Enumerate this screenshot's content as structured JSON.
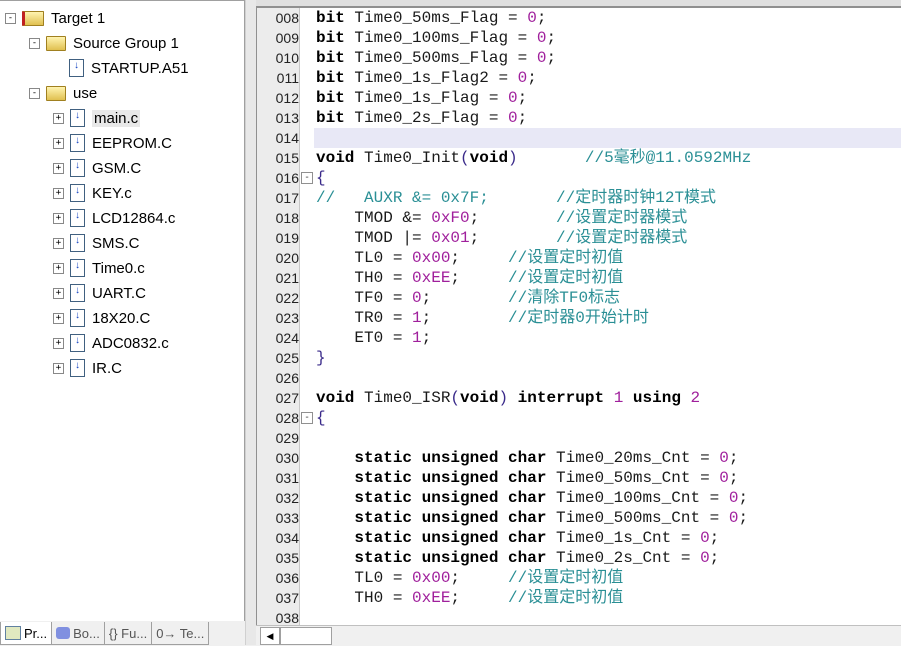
{
  "tree": [
    {
      "label": "Target 1",
      "level": 0,
      "exp": "−",
      "icon": "target"
    },
    {
      "label": "Source Group 1",
      "level": 1,
      "exp": "−",
      "icon": "folder"
    },
    {
      "label": "STARTUP.A51",
      "level": 2,
      "exp": "",
      "icon": "file"
    },
    {
      "label": "use",
      "level": 1,
      "exp": "−",
      "icon": "folder"
    },
    {
      "label": "main.c",
      "level": 2,
      "exp": "+",
      "icon": "file",
      "selected": true
    },
    {
      "label": "EEPROM.C",
      "level": 2,
      "exp": "+",
      "icon": "file"
    },
    {
      "label": "GSM.C",
      "level": 2,
      "exp": "+",
      "icon": "file"
    },
    {
      "label": "KEY.c",
      "level": 2,
      "exp": "+",
      "icon": "file"
    },
    {
      "label": "LCD12864.c",
      "level": 2,
      "exp": "+",
      "icon": "file"
    },
    {
      "label": "SMS.C",
      "level": 2,
      "exp": "+",
      "icon": "file"
    },
    {
      "label": "Time0.c",
      "level": 2,
      "exp": "+",
      "icon": "file"
    },
    {
      "label": "UART.C",
      "level": 2,
      "exp": "+",
      "icon": "file"
    },
    {
      "label": "18X20.C",
      "level": 2,
      "exp": "+",
      "icon": "file"
    },
    {
      "label": "ADC0832.c",
      "level": 2,
      "exp": "+",
      "icon": "file"
    },
    {
      "label": "IR.C",
      "level": 2,
      "exp": "+",
      "icon": "file"
    }
  ],
  "tabs": [
    {
      "label": "Pr...",
      "icon": "project-icon"
    },
    {
      "label": "Bo...",
      "icon": "books-icon"
    },
    {
      "label": "{} Fu...",
      "icon": "functions-icon"
    },
    {
      "label": "0→ Te...",
      "icon": "templates-icon"
    }
  ],
  "code": [
    {
      "ln": "008",
      "seg": [
        [
          "bit",
          "k"
        ],
        " Time0_50ms_Flag = ",
        [
          "0",
          "n"
        ],
        ";"
      ]
    },
    {
      "ln": "009",
      "seg": [
        [
          "bit",
          "k"
        ],
        " Time0_100ms_Flag = ",
        [
          "0",
          "n"
        ],
        ";"
      ]
    },
    {
      "ln": "010",
      "seg": [
        [
          "bit",
          "k"
        ],
        " Time0_500ms_Flag = ",
        [
          "0",
          "n"
        ],
        ";"
      ]
    },
    {
      "ln": "011",
      "seg": [
        [
          "bit",
          "k"
        ],
        " Time0_1s_Flag2 = ",
        [
          "0",
          "n"
        ],
        ";"
      ]
    },
    {
      "ln": "012",
      "seg": [
        [
          "bit",
          "k"
        ],
        " Time0_1s_Flag = ",
        [
          "0",
          "n"
        ],
        ";"
      ]
    },
    {
      "ln": "013",
      "seg": [
        [
          "bit",
          "k"
        ],
        " Time0_2s_Flag = ",
        [
          "0",
          "n"
        ],
        ";"
      ]
    },
    {
      "ln": "014",
      "seg": [],
      "current": true
    },
    {
      "ln": "015",
      "seg": [
        [
          "void",
          "k"
        ],
        " Time0_Init",
        [
          "(",
          "p"
        ],
        [
          "void",
          "k"
        ],
        [
          ")",
          "p"
        ],
        "       ",
        [
          "//5毫秒@11.0592MHz",
          "c"
        ]
      ]
    },
    {
      "ln": "016",
      "seg": [
        [
          "{",
          "p"
        ]
      ],
      "fold": true
    },
    {
      "ln": "017",
      "seg": [
        [
          "//   AUXR &= 0x7F;       //定时器时钟12T模式",
          "c"
        ]
      ]
    },
    {
      "ln": "018",
      "seg": [
        "    TMOD &= ",
        [
          "0xF0",
          "n"
        ],
        ";        ",
        [
          "//设置定时器模式",
          "c"
        ]
      ]
    },
    {
      "ln": "019",
      "seg": [
        "    TMOD |= ",
        [
          "0x01",
          "n"
        ],
        ";        ",
        [
          "//设置定时器模式",
          "c"
        ]
      ]
    },
    {
      "ln": "020",
      "seg": [
        "    TL0 = ",
        [
          "0x00",
          "n"
        ],
        ";     ",
        [
          "//设置定时初值",
          "c"
        ]
      ]
    },
    {
      "ln": "021",
      "seg": [
        "    TH0 = ",
        [
          "0xEE",
          "n"
        ],
        ";     ",
        [
          "//设置定时初值",
          "c"
        ]
      ]
    },
    {
      "ln": "022",
      "seg": [
        "    TF0 = ",
        [
          "0",
          "n"
        ],
        ";        ",
        [
          "//清除TF0标志",
          "c"
        ]
      ]
    },
    {
      "ln": "023",
      "seg": [
        "    TR0 = ",
        [
          "1",
          "n"
        ],
        ";        ",
        [
          "//定时器0开始计时",
          "c"
        ]
      ]
    },
    {
      "ln": "024",
      "seg": [
        "    ET0 = ",
        [
          "1",
          "n"
        ],
        ";"
      ]
    },
    {
      "ln": "025",
      "seg": [
        [
          "}",
          "p"
        ]
      ]
    },
    {
      "ln": "026",
      "seg": []
    },
    {
      "ln": "027",
      "seg": [
        [
          "void",
          "k"
        ],
        " Time0_ISR",
        [
          "(",
          "p"
        ],
        [
          "void",
          "k"
        ],
        [
          ")",
          "p"
        ],
        " ",
        [
          "interrupt",
          "k"
        ],
        " ",
        [
          "1",
          "n"
        ],
        " ",
        [
          "using",
          "k"
        ],
        " ",
        [
          "2",
          "n"
        ]
      ]
    },
    {
      "ln": "028",
      "seg": [
        [
          "{",
          "p"
        ]
      ],
      "fold": true
    },
    {
      "ln": "029",
      "seg": []
    },
    {
      "ln": "030",
      "seg": [
        "    ",
        [
          "static unsigned char",
          "k"
        ],
        " Time0_20ms_Cnt = ",
        [
          "0",
          "n"
        ],
        ";"
      ]
    },
    {
      "ln": "031",
      "seg": [
        "    ",
        [
          "static unsigned char",
          "k"
        ],
        " Time0_50ms_Cnt = ",
        [
          "0",
          "n"
        ],
        ";"
      ]
    },
    {
      "ln": "032",
      "seg": [
        "    ",
        [
          "static unsigned char",
          "k"
        ],
        " Time0_100ms_Cnt = ",
        [
          "0",
          "n"
        ],
        ";"
      ]
    },
    {
      "ln": "033",
      "seg": [
        "    ",
        [
          "static unsigned char",
          "k"
        ],
        " Time0_500ms_Cnt = ",
        [
          "0",
          "n"
        ],
        ";"
      ]
    },
    {
      "ln": "034",
      "seg": [
        "    ",
        [
          "static unsigned char",
          "k"
        ],
        " Time0_1s_Cnt = ",
        [
          "0",
          "n"
        ],
        ";"
      ]
    },
    {
      "ln": "035",
      "seg": [
        "    ",
        [
          "static unsigned char",
          "k"
        ],
        " Time0_2s_Cnt = ",
        [
          "0",
          "n"
        ],
        ";"
      ]
    },
    {
      "ln": "036",
      "seg": [
        "    TL0 = ",
        [
          "0x00",
          "n"
        ],
        ";     ",
        [
          "//设置定时初值",
          "c"
        ]
      ]
    },
    {
      "ln": "037",
      "seg": [
        "    TH0 = ",
        [
          "0xEE",
          "n"
        ],
        ";     ",
        [
          "//设置定时初值",
          "c"
        ]
      ]
    },
    {
      "ln": "038",
      "seg": []
    }
  ],
  "colors": {
    "keyword": "#000000",
    "number": "#a0209c",
    "comment": "#2a8f95",
    "current_line": "#e8e8f6"
  }
}
